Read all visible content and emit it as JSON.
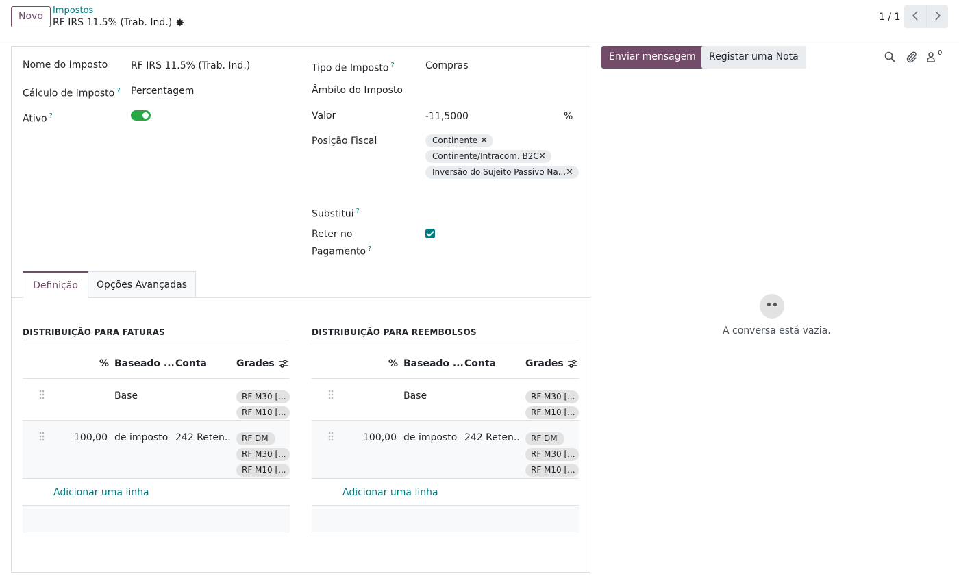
{
  "control_panel": {
    "new_button": "Novo",
    "breadcrumb_parent": "Impostos",
    "breadcrumb_current": "RF IRS 11.5% (Trab. Ind.)",
    "pager_value": "1 / 1"
  },
  "form": {
    "tax_name_label": "Nome do Imposto",
    "tax_name_value": "RF IRS 11.5% (Trab. Ind.)",
    "tax_computation_label": "Cálculo de Imposto",
    "tax_computation_value": "Percentagem",
    "active_label": "Ativo",
    "active_value": true,
    "tax_type_label": "Tipo de Imposto",
    "tax_type_value": "Compras",
    "tax_scope_label": "Âmbito do Imposto",
    "tax_scope_value": "",
    "amount_label": "Valor",
    "amount_value": "-11,5000",
    "amount_unit": "%",
    "fiscal_position_label": "Posição Fiscal",
    "fiscal_positions": [
      "Continente",
      "Continente/Intracom. B2C",
      "Inversão do Sujeito Passivo Na..."
    ],
    "replaces_label": "Substitui",
    "withhold_label_line1": "Reter no",
    "withhold_label_line2": "Pagamento",
    "withhold_value": true,
    "help_mark": "?"
  },
  "tabs": [
    {
      "label": "Definição",
      "active": true
    },
    {
      "label": "Opções Avançadas",
      "active": false
    }
  ],
  "invoice_distribution": {
    "title": "DISTRIBUIÇÃO PARA FATURAS",
    "columns": {
      "percent": "%",
      "based_on": "Baseado ...",
      "account": "Conta",
      "grids": "Grades"
    },
    "rows": [
      {
        "percent": "",
        "based_on": "Base",
        "account": "",
        "grids": [
          "RF M30 [...",
          "RF M10 [..."
        ]
      },
      {
        "percent": "100,00",
        "based_on": "de imposto",
        "account": "242 Reten...",
        "grids": [
          "RF DM",
          "RF M30 [...",
          "RF M10 [..."
        ]
      }
    ],
    "add_line": "Adicionar uma linha"
  },
  "refund_distribution": {
    "title": "DISTRIBUIÇÃO PARA REEMBOLSOS",
    "columns": {
      "percent": "%",
      "based_on": "Baseado ...",
      "account": "Conta",
      "grids": "Grades"
    },
    "rows": [
      {
        "percent": "",
        "based_on": "Base",
        "account": "",
        "grids": [
          "RF M30 [...",
          "RF M10 [..."
        ]
      },
      {
        "percent": "100,00",
        "based_on": "de imposto",
        "account": "242 Reten...",
        "grids": [
          "RF DM",
          "RF M30 [...",
          "RF M10 [..."
        ]
      }
    ],
    "add_line": "Adicionar uma linha"
  },
  "chatter": {
    "send_message": "Enviar mensagem",
    "log_note": "Registar uma Nota",
    "followers_count": "0",
    "empty_text": "A conversa está vazia."
  },
  "colors": {
    "brand": "#714b67",
    "link": "#017e84",
    "toggle_on": "#28a745"
  }
}
